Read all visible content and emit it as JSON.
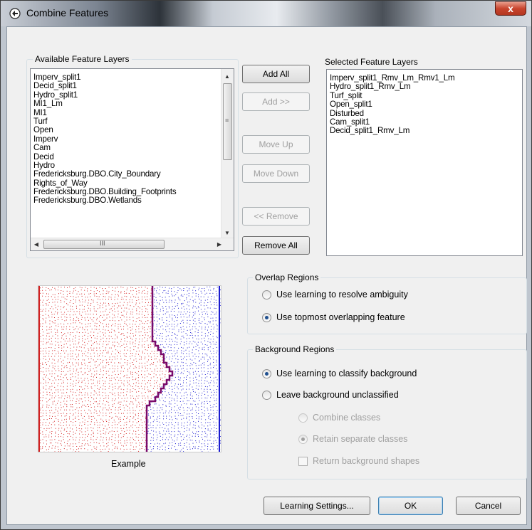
{
  "window": {
    "title": "Combine Features",
    "close_symbol": "x"
  },
  "available": {
    "label": "Available Feature Layers",
    "items": [
      "Imperv_split1",
      "Decid_split1",
      "Hydro_split1",
      "MI1_Lm",
      "MI1",
      "Turf",
      "Open",
      "Imperv",
      "Cam",
      "Decid",
      "Hydro",
      "Fredericksburg.DBO.City_Boundary",
      "Rights_of_Way",
      "Fredericksburg.DBO.Building_Footprints",
      "Fredericksburg.DBO.Wetlands"
    ],
    "hscroll_grip": "III",
    "vscroll_grip": "≡"
  },
  "selected": {
    "label": "Selected Feature Layers",
    "items": [
      "Imperv_split1_Rmv_Lm_Rmv1_Lm",
      "Hydro_split1_Rmv_Lm",
      "Turf_split",
      "Open_split1",
      "Disturbed",
      "Cam_split1",
      "Decid_split1_Rmv_Lm"
    ]
  },
  "buttons": {
    "add_all": "Add All",
    "add": "Add >>",
    "move_up": "Move Up",
    "move_down": "Move Down",
    "remove": "<< Remove",
    "remove_all": "Remove All",
    "learning_settings": "Learning Settings...",
    "ok": "OK",
    "cancel": "Cancel"
  },
  "overlap": {
    "label": "Overlap Regions",
    "opt1": "Use learning to resolve ambiguity",
    "opt2": "Use topmost overlapping feature",
    "selected": 2
  },
  "background": {
    "label": "Background Regions",
    "opt1": "Use learning to classify background",
    "opt2": "Leave background unclassified",
    "sub1": "Combine classes",
    "sub2": "Retain separate classes",
    "check": "Return background shapes",
    "selected": 1,
    "sub_selected": 2,
    "check_checked": false
  },
  "example": {
    "label": "Example",
    "left_color": "#d42020",
    "right_color": "#1a1ad0",
    "boundary_color": "#7a0a6a"
  },
  "icons": {
    "app": "app-icon",
    "close": "close-icon"
  }
}
